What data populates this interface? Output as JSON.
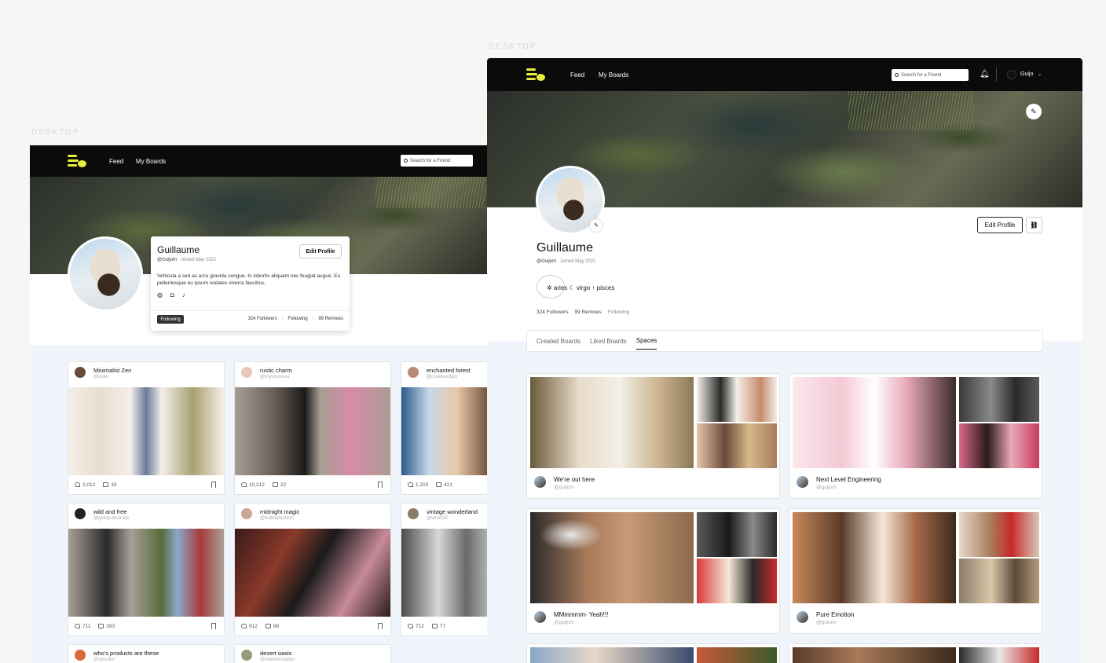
{
  "captions": {
    "left": "DESKTOP",
    "right": "DESKTOP"
  },
  "brand": {
    "accent": "#e6ee3a",
    "nav_bg": "#0b0b0b",
    "page_bg": "#f0f4fb"
  },
  "nav": {
    "feed": "Feed",
    "boards": "My Boards",
    "search_placeholder": "Search for a Friend",
    "user": "Guijo"
  },
  "left_profile": {
    "name": "Guillaume",
    "handle": "@Guijom",
    "joined": "Joined May 2021",
    "bio": "Vehicula a sed ac arcu gravida congue. In lobortis aliquam nec feugiat augue. Eu pellentesque eu ipsum sodales viverra faucibus.",
    "edit": "Edit Profile",
    "following_badge": "Following",
    "followers": "324 Followers",
    "following": "Following",
    "remixes": "99 Remixes",
    "social_icons": [
      "globe-icon",
      "instagram-icon",
      "tiktok-icon"
    ]
  },
  "left_boards": [
    {
      "title": "Minimalist Zen",
      "user": "@xuan",
      "likes": "2,012",
      "comments": "33"
    },
    {
      "title": "rustic charm",
      "user": "@mysticmuse",
      "likes": "10,212",
      "comments": "22"
    },
    {
      "title": "enchanted forest",
      "user": "@creativeclip1",
      "likes": "1,203",
      "comments": "421"
    },
    {
      "title": "wild and free",
      "user": "@going-distance",
      "likes": "711",
      "comments": "283"
    },
    {
      "title": "midnight magic",
      "user": "@bailingfashion",
      "likes": "912",
      "comments": "88"
    },
    {
      "title": "vintage wonderland",
      "user": "@who032",
      "likes": "712",
      "comments": "77"
    },
    {
      "title": "who's products are these",
      "user": "@xproduc",
      "likes": "",
      "comments": ""
    },
    {
      "title": "desert oasis",
      "user": "@internet-explor",
      "likes": "",
      "comments": ""
    }
  ],
  "right_profile": {
    "name": "Guillaume",
    "handle": "@Guijom",
    "joined": "Joined May 2021",
    "zodiac": "✲ aries  ☾ virgo  ↑ pisces",
    "followers": "324 Followers",
    "remixes": "99 Remixes",
    "following": "Following",
    "edit": "Edit Profile"
  },
  "tabs": [
    "Created Boards",
    "Liked Boards",
    "Spaces"
  ],
  "active_tab": "Spaces",
  "spaces": [
    {
      "title": "We're out here",
      "user": "@guijom"
    },
    {
      "title": "Next Level Engineering",
      "user": "@guijom"
    },
    {
      "title": "MMmmmm- Yeah!!!",
      "user": "@guijom"
    },
    {
      "title": "Pure Emotion",
      "user": "@guijom"
    }
  ]
}
